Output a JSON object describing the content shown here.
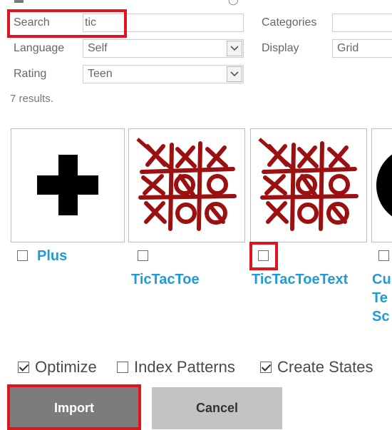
{
  "filters": {
    "search_label": "Search",
    "search_value": "tic",
    "categories_label": "Categories",
    "categories_value": "",
    "language_label": "Language",
    "language_value": "Self",
    "display_label": "Display",
    "display_value": "Grid",
    "rating_label": "Rating",
    "rating_value": "Teen"
  },
  "results_text": "7 results.",
  "symbols": [
    {
      "name": "Plus",
      "icon": "plus-icon"
    },
    {
      "name": "TicTacToe",
      "icon": "tictactoe-icon"
    },
    {
      "name": "TicTacToeText",
      "icon": "tictactoe-icon"
    },
    {
      "name": "Cu Te Sc",
      "name_lines": [
        "Cu",
        "Te",
        "Sc"
      ],
      "icon": "black-circle-icon"
    }
  ],
  "options": {
    "optimize": "Optimize",
    "index_patterns": "Index Patterns",
    "create_states": "Create States",
    "optimize_checked": true,
    "index_patterns_checked": false,
    "create_states_checked": true
  },
  "buttons": {
    "import": "Import",
    "cancel": "Cancel"
  },
  "colors": {
    "accent": "#1f9bd6",
    "highlight": "#e0141e",
    "ink": "#9b1111"
  }
}
